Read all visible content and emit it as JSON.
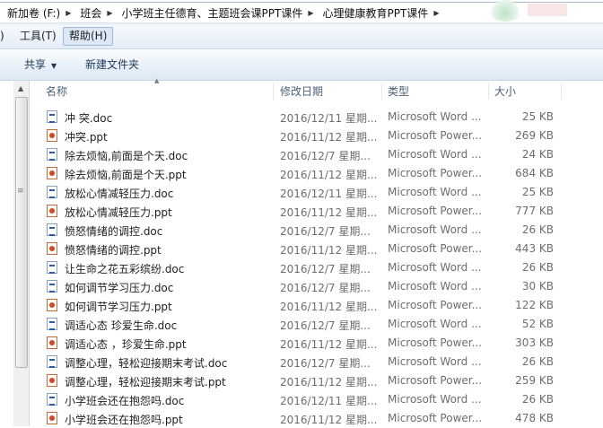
{
  "address_bar": {
    "crumbs": [
      "新加卷 (F:)",
      "班会",
      "小学班主任德育、主题班会课PPT课件",
      "心理健康教育PPT课件"
    ]
  },
  "menu": {
    "items": [
      ")",
      "工具(T)",
      "帮助(H)"
    ]
  },
  "toolbar": {
    "share_label": "共享",
    "new_folder_label": "新建文件夹"
  },
  "columns": {
    "name": "名称",
    "date": "修改日期",
    "type": "类型",
    "size": "大小"
  },
  "files": [
    {
      "name": "冲 突.doc",
      "date": "2016/12/11 星期...",
      "type": "Microsoft Word ...",
      "size": "25 KB",
      "kind": "doc"
    },
    {
      "name": "冲突.ppt",
      "date": "2016/11/12 星期...",
      "type": "Microsoft Power...",
      "size": "269 KB",
      "kind": "ppt"
    },
    {
      "name": "除去烦恼,前面是个天.doc",
      "date": "2016/12/7 星期...",
      "type": "Microsoft Word ...",
      "size": "24 KB",
      "kind": "doc"
    },
    {
      "name": "除去烦恼,前面是个天.ppt",
      "date": "2016/11/12 星期...",
      "type": "Microsoft Power...",
      "size": "684 KB",
      "kind": "ppt"
    },
    {
      "name": "放松心情减轻压力.doc",
      "date": "2016/12/11 星期...",
      "type": "Microsoft Word ...",
      "size": "25 KB",
      "kind": "doc"
    },
    {
      "name": "放松心情减轻压力.ppt",
      "date": "2016/11/12 星期...",
      "type": "Microsoft Power...",
      "size": "777 KB",
      "kind": "ppt"
    },
    {
      "name": "愤怒情绪的调控.doc",
      "date": "2016/12/7 星期...",
      "type": "Microsoft Word ...",
      "size": "26 KB",
      "kind": "doc"
    },
    {
      "name": "愤怒情绪的调控.ppt",
      "date": "2016/11/12 星期...",
      "type": "Microsoft Power...",
      "size": "443 KB",
      "kind": "ppt"
    },
    {
      "name": "让生命之花五彩缤纷.doc",
      "date": "2016/12/7 星期...",
      "type": "Microsoft Word ...",
      "size": "26 KB",
      "kind": "doc"
    },
    {
      "name": "如何调节学习压力.doc",
      "date": "2016/12/7 星期...",
      "type": "Microsoft Word ...",
      "size": "30 KB",
      "kind": "doc"
    },
    {
      "name": "如何调节学习压力.ppt",
      "date": "2016/11/12 星期...",
      "type": "Microsoft Power...",
      "size": "122 KB",
      "kind": "ppt"
    },
    {
      "name": "调适心态 珍爱生命.doc",
      "date": "2016/12/7 星期...",
      "type": "Microsoft Word ...",
      "size": "52 KB",
      "kind": "doc"
    },
    {
      "name": "调适心态 ，珍爱生命.ppt",
      "date": "2016/11/12 星期...",
      "type": "Microsoft Power...",
      "size": "303 KB",
      "kind": "ppt"
    },
    {
      "name": "调整心理，轻松迎接期末考试.doc",
      "date": "2016/12/7 星期...",
      "type": "Microsoft Word ...",
      "size": "26 KB",
      "kind": "doc"
    },
    {
      "name": "调整心理，轻松迎接期末考试.ppt",
      "date": "2016/11/12 星期...",
      "type": "Microsoft Power...",
      "size": "259 KB",
      "kind": "ppt"
    },
    {
      "name": "小学班会还在抱怨吗.doc",
      "date": "2016/12/11 星期...",
      "type": "Microsoft Word ...",
      "size": "26 KB",
      "kind": "doc"
    },
    {
      "name": "小学班会还在抱怨吗.ppt",
      "date": "2016/11/12 星期...",
      "type": "Microsoft Power...",
      "size": "478 KB",
      "kind": "ppt"
    }
  ]
}
